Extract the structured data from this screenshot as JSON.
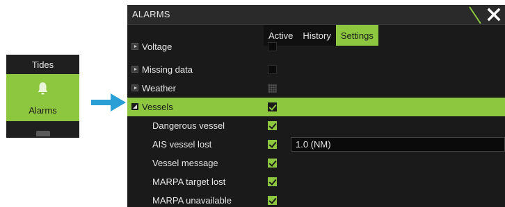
{
  "side_menu": {
    "top_label": "Tides",
    "active_label": "Alarms"
  },
  "dialog": {
    "title": "ALARMS",
    "tabs": [
      "Active",
      "History",
      "Settings"
    ],
    "active_tab": "Settings",
    "rows": [
      {
        "label": "Voltage",
        "checked": false
      },
      {
        "label": "Missing data",
        "checked": false
      },
      {
        "label": "Weather",
        "checked": false
      },
      {
        "label": "Vessels",
        "checked": true
      },
      {
        "label": "Dangerous vessel",
        "checked": true
      },
      {
        "label": "AIS vessel lost",
        "checked": true,
        "value": "1.0 (NM)"
      },
      {
        "label": "Vessel message",
        "checked": true
      },
      {
        "label": "MARPA target lost",
        "checked": true
      },
      {
        "label": "MARPA unavailable",
        "checked": true
      }
    ]
  },
  "colors": {
    "accent": "#8dc63f",
    "arrow": "#2a9fd6",
    "panel": "#1a1a1a"
  }
}
